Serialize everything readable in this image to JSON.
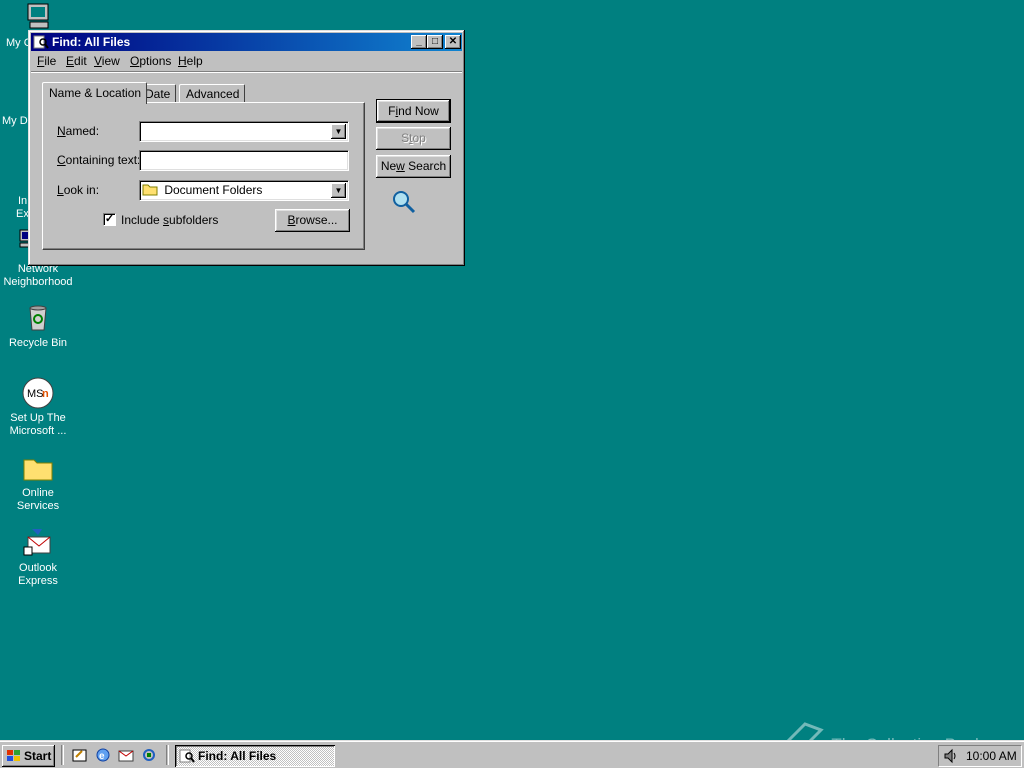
{
  "desktop": {
    "icons": [
      {
        "label": "My C"
      },
      {
        "label": "My D"
      },
      {
        "label": "In"
      },
      {
        "label": "Ex"
      },
      {
        "label": "Network Neighborhood"
      },
      {
        "label": "Recycle Bin"
      },
      {
        "label": "Set Up The Microsoft ..."
      },
      {
        "label": "Online Services"
      },
      {
        "label": "Outlook Express"
      }
    ]
  },
  "window": {
    "title": "Find: All Files",
    "controls": {
      "minimize": "_",
      "maximize": "□",
      "close": "✕"
    },
    "menu": [
      {
        "key": "F",
        "rest": "ile"
      },
      {
        "key": "E",
        "rest": "dit"
      },
      {
        "key": "V",
        "rest": "iew"
      },
      {
        "key": "O",
        "rest": "ptions"
      },
      {
        "key": "H",
        "rest": "elp"
      }
    ],
    "tabs": [
      "Name & Location",
      "Date",
      "Advanced"
    ],
    "fields": {
      "named": {
        "key": "N",
        "rest": "amed:",
        "value": ""
      },
      "containing": {
        "key": "C",
        "rest": "ontaining text:",
        "value": ""
      },
      "lookin": {
        "key": "L",
        "rest": "ook in:",
        "value": "Document Folders"
      }
    },
    "include_subfolders": {
      "pre": "Include ",
      "key": "s",
      "rest": "ubfolders",
      "checked": true,
      "mark": "✓"
    },
    "buttons": {
      "browse": {
        "key": "B",
        "rest": "rowse..."
      },
      "find_now": {
        "key": "i",
        "pre": "F",
        "rest": "nd Now"
      },
      "stop": {
        "pre": "S",
        "key": "t",
        "rest": "op"
      },
      "new_search": {
        "key": "w",
        "pre": "Ne",
        "rest": " Search"
      }
    }
  },
  "taskbar": {
    "start_label": "Start",
    "task_label": "Find: All Files",
    "clock": "10:00 AM"
  },
  "watermark": "The Collection Book",
  "colors": {
    "desktop": "#008080",
    "title_start": "#000080",
    "title_end": "#1084d0",
    "face": "#c0c0c0"
  }
}
